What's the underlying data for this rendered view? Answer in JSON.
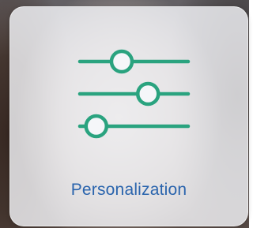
{
  "card": {
    "label": "Personalization",
    "icon": "sliders-icon",
    "icon_color": "#2aa37f",
    "label_color": "#2a64ad"
  },
  "sliders": {
    "levels": [
      0.36,
      0.66,
      0.07
    ]
  }
}
